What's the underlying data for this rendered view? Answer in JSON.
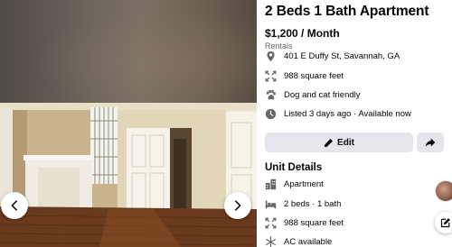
{
  "listing": {
    "title": "2 Beds 1 Bath Apartment",
    "price": "$1,200 / Month",
    "category": "Rentals",
    "address": "401 E Duffy St, Savannah, GA",
    "size": "988 square feet",
    "pets": "Dog and cat friendly",
    "listed": "Listed 3 days ago · Available now"
  },
  "actions": {
    "edit_label": "Edit"
  },
  "unit_details": {
    "heading": "Unit Details",
    "type": "Apartment",
    "rooms": "2 beds · 1 bath",
    "size": "988 square feet",
    "ac": "AC available"
  },
  "icons": {
    "location": "location-pin-icon",
    "size": "expand-icon",
    "pets": "paw-icon",
    "time": "clock-icon",
    "edit": "pencil-icon",
    "share": "share-arrow-icon",
    "prev": "chevron-left-icon",
    "next": "chevron-right-icon",
    "building": "building-icon",
    "bed": "bed-icon",
    "ac": "snowflake-icon",
    "compose": "compose-icon"
  },
  "colors": {
    "text_primary": "#050505",
    "text_secondary": "#65676b",
    "icon_gray": "#65676b",
    "button_bg": "#e4e6eb"
  }
}
